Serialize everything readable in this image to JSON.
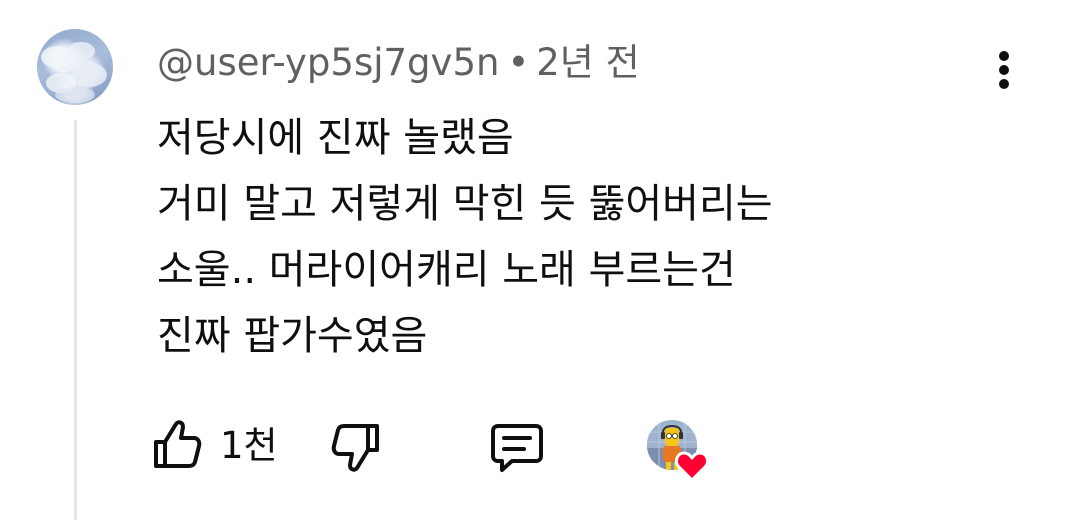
{
  "comment": {
    "author": "@user-yp5sj7gv5n",
    "separator": "•",
    "timestamp": "2년 전",
    "lines": [
      "저당시에 진짜 놀랬음",
      "거미 말고 저렇게 막힌 듯 뚫어버리는",
      "소울.. 머라이어캐리 노래 부르는건",
      "진짜 팝가수였음"
    ]
  },
  "actions": {
    "like_count": "1천"
  },
  "icons": {
    "more": "more-vert-icon",
    "like": "thumbs-up-icon",
    "dislike": "thumbs-down-icon",
    "reply": "comment-icon",
    "creator_heart": "heart-icon"
  },
  "colors": {
    "text": "#0f0f0f",
    "secondary_text": "#606060",
    "heart": "#ff0033",
    "thread_line": "#e5e5e5"
  }
}
